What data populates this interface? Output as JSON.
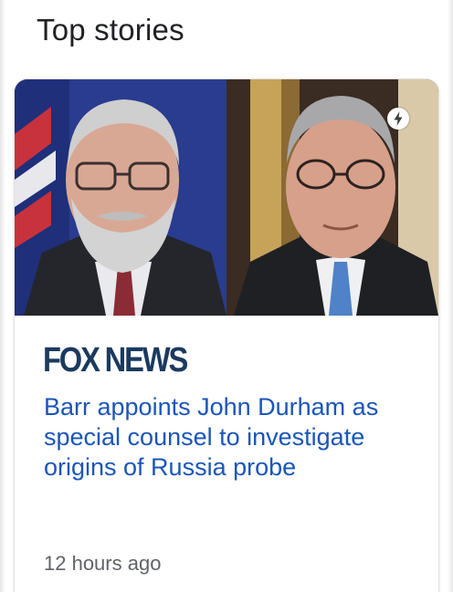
{
  "section": {
    "title": "Top stories"
  },
  "story": {
    "source": "FOX NEWS",
    "headline": "Barr appoints John Durham as special counsel to investigate origins of Russia probe",
    "time": "12 hours ago",
    "thumbnail_icon": "photo-icon",
    "badge_icon": "amp-lightning-icon"
  },
  "colors": {
    "headline": "#1a56b8",
    "source_logo": "#1b3a5f",
    "title": "#202124",
    "timestamp": "#5f6368"
  }
}
